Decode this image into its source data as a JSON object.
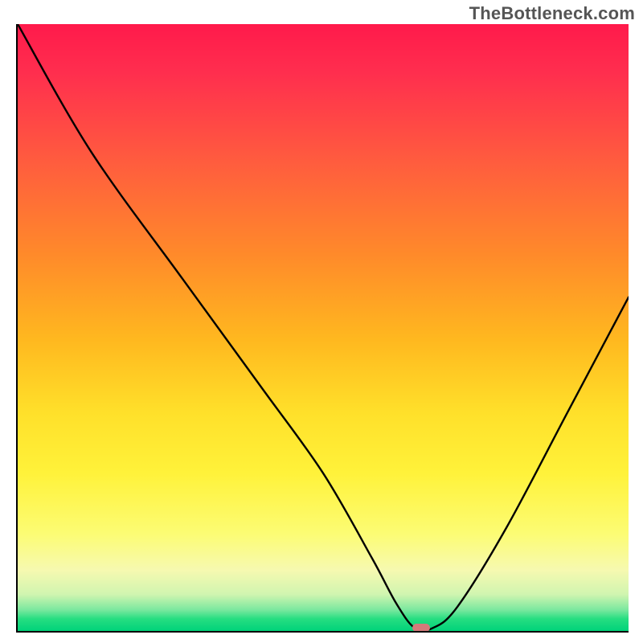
{
  "watermark": "TheBottleneck.com",
  "colors": {
    "gradient_top": "#ff1a4b",
    "gradient_bottom": "#00d27a",
    "curve": "#000000",
    "marker": "#d47a7a",
    "axis": "#000000"
  },
  "chart_data": {
    "type": "line",
    "title": "",
    "xlabel": "",
    "ylabel": "",
    "xlim": [
      0,
      100
    ],
    "ylim": [
      0,
      100
    ],
    "x": [
      0,
      12,
      27,
      40,
      50,
      58,
      62,
      65,
      68,
      72,
      80,
      90,
      100
    ],
    "values": [
      100,
      79,
      58,
      40,
      26,
      12,
      4.5,
      0.5,
      0.5,
      4,
      17,
      36,
      55
    ],
    "annotations": [
      {
        "type": "marker",
        "x": 66,
        "y": 0.5,
        "shape": "pill",
        "color": "#d47a7a"
      }
    ],
    "background": "vertical-gradient red→orange→yellow→green"
  }
}
